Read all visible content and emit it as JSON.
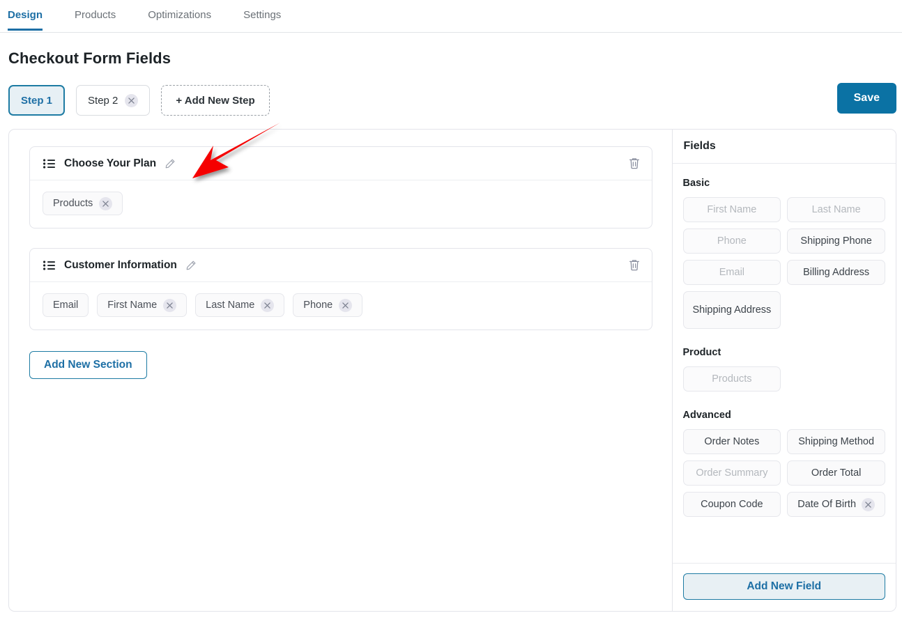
{
  "nav": {
    "tabs": [
      {
        "label": "Design",
        "active": true
      },
      {
        "label": "Products",
        "active": false
      },
      {
        "label": "Optimizations",
        "active": false
      },
      {
        "label": "Settings",
        "active": false
      }
    ]
  },
  "page": {
    "title": "Checkout Form Fields"
  },
  "steps": {
    "items": [
      {
        "label": "Step 1",
        "active": true,
        "removable": false
      },
      {
        "label": "Step 2",
        "active": false,
        "removable": true
      }
    ],
    "add_label": "+ Add New Step",
    "save_label": "Save"
  },
  "canvas": {
    "sections": [
      {
        "title": "Choose Your Plan",
        "fields": [
          {
            "label": "Products",
            "removable": true
          }
        ]
      },
      {
        "title": "Customer Information",
        "fields": [
          {
            "label": "Email",
            "removable": false
          },
          {
            "label": "First Name",
            "removable": true
          },
          {
            "label": "Last Name",
            "removable": true
          },
          {
            "label": "Phone",
            "removable": true
          }
        ]
      }
    ],
    "add_section_label": "Add New Section"
  },
  "fields_panel": {
    "title": "Fields",
    "groups": [
      {
        "label": "Basic",
        "items": [
          {
            "label": "First Name",
            "disabled": true,
            "removable": false
          },
          {
            "label": "Last Name",
            "disabled": true,
            "removable": false
          },
          {
            "label": "Phone",
            "disabled": true,
            "removable": false
          },
          {
            "label": "Shipping Phone",
            "disabled": false,
            "removable": false
          },
          {
            "label": "Email",
            "disabled": true,
            "removable": false
          },
          {
            "label": "Billing Address",
            "disabled": false,
            "removable": false
          },
          {
            "label": "Shipping Address",
            "disabled": false,
            "removable": false,
            "tall": true
          }
        ]
      },
      {
        "label": "Product",
        "items": [
          {
            "label": "Products",
            "disabled": true,
            "removable": false,
            "left": true
          }
        ]
      },
      {
        "label": "Advanced",
        "items": [
          {
            "label": "Order Notes",
            "disabled": false,
            "removable": false
          },
          {
            "label": "Shipping Method",
            "disabled": false,
            "removable": false
          },
          {
            "label": "Order Summary",
            "disabled": true,
            "removable": false
          },
          {
            "label": "Order Total",
            "disabled": false,
            "removable": false
          },
          {
            "label": "Coupon Code",
            "disabled": false,
            "removable": false
          },
          {
            "label": "Date Of Birth",
            "disabled": false,
            "removable": true
          }
        ]
      }
    ],
    "add_field_label": "Add New Field"
  },
  "annotation": {
    "type": "arrow",
    "color": "#f50000"
  },
  "colors": {
    "accent_blue": "#1d6fa5",
    "save_blue": "#0b72a4",
    "border": "#e3e4ea",
    "arrow_red": "#f50000"
  }
}
